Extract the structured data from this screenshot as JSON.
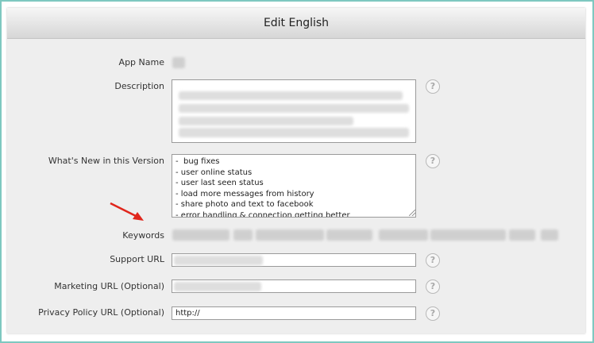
{
  "window": {
    "title": "Edit English"
  },
  "form": {
    "app_name_label": "App Name",
    "description_label": "Description",
    "whats_new_label": "What's New in this Version",
    "whats_new_value": "-  bug fixes\n- user online status\n- user last seen status\n- load more messages from history\n- share photo and text to facebook\n- error handling & connection getting better",
    "keywords_label": "Keywords",
    "support_url_label": "Support URL",
    "marketing_url_label": "Marketing URL (Optional)",
    "privacy_url_label": "Privacy Policy URL (Optional)",
    "privacy_url_value": "http://"
  },
  "help_glyph": "?",
  "colors": {
    "frame": "#7ec8c0",
    "arrow": "#e0261c"
  }
}
